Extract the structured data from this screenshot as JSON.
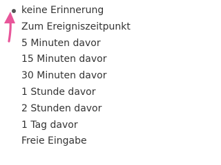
{
  "reminder_menu": {
    "selected_index": 0,
    "items": [
      {
        "label": "keine Erinnerung"
      },
      {
        "label": "Zum Ereigniszeitpunkt"
      },
      {
        "label": "5 Minuten davor"
      },
      {
        "label": "15 Minuten davor"
      },
      {
        "label": "30 Minuten davor"
      },
      {
        "label": "1 Stunde davor"
      },
      {
        "label": "2 Stunden davor"
      },
      {
        "label": "1 Tag davor"
      },
      {
        "label": "Freie Eingabe"
      }
    ]
  },
  "annotation": {
    "arrow_color": "#e8569a",
    "icon": "arrow-up-icon"
  }
}
